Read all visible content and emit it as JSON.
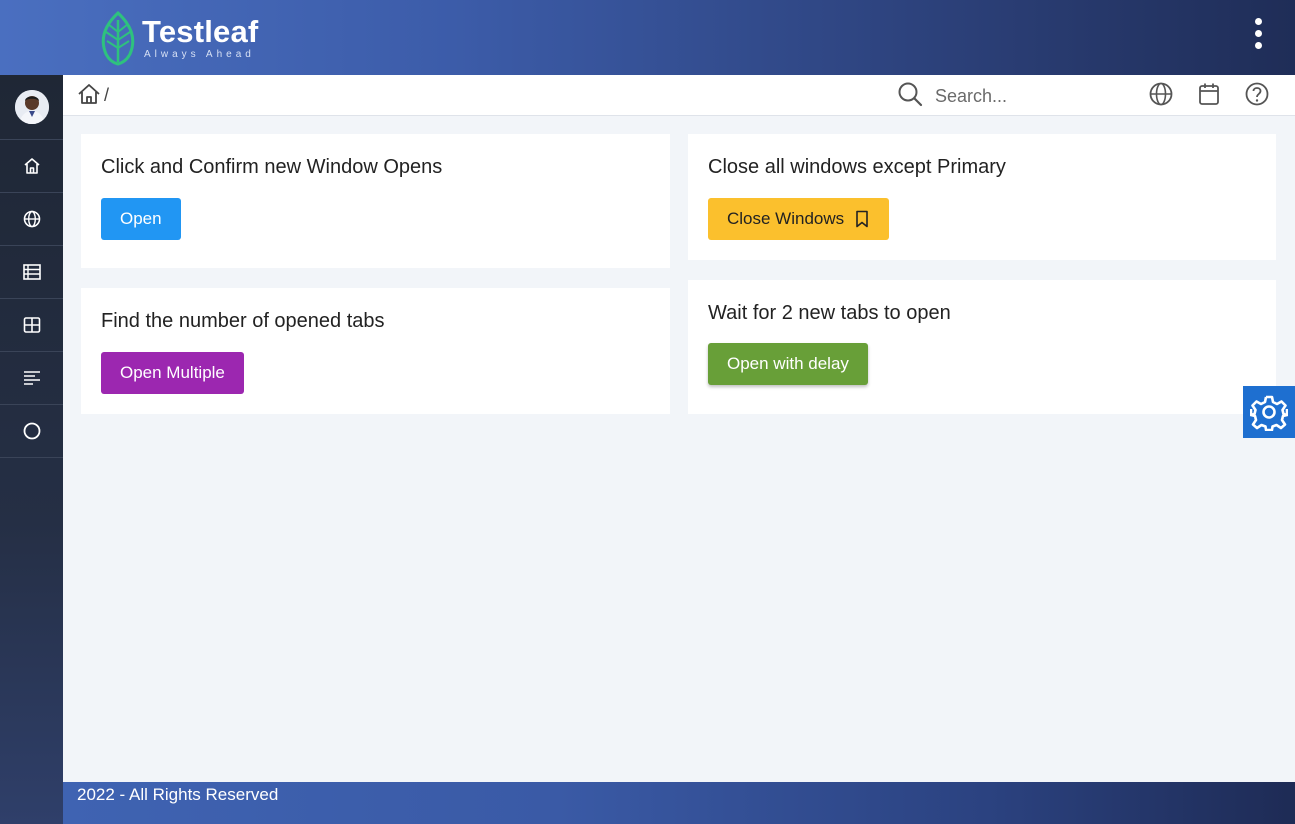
{
  "brand": {
    "name": "Testleaf",
    "tagline": "Always Ahead"
  },
  "header": {
    "menu_icon": "kebab-menu-icon"
  },
  "sidebar": {
    "items": [
      {
        "icon": "home-icon"
      },
      {
        "icon": "globe-icon"
      },
      {
        "icon": "table-icon"
      },
      {
        "icon": "grid-icon"
      },
      {
        "icon": "align-left-icon"
      },
      {
        "icon": "circle-icon"
      }
    ]
  },
  "breadcrumb": {
    "separator": "/"
  },
  "search": {
    "placeholder": "Search..."
  },
  "cards": {
    "window_open": {
      "title": "Click and Confirm new Window Opens",
      "button": "Open"
    },
    "close_windows": {
      "title": "Close all windows except Primary",
      "button": "Close Windows"
    },
    "count_tabs": {
      "title": "Find the number of opened tabs",
      "button": "Open Multiple"
    },
    "wait_tabs": {
      "title": "Wait for 2 new tabs to open",
      "button": "Open with delay"
    }
  },
  "footer": {
    "text": "2022 - All Rights Reserved"
  },
  "colors": {
    "button_blue": "#2196f3",
    "button_yellow": "#fbc02d",
    "button_purple": "#9c27b0",
    "button_green": "#689f38",
    "settings_blue": "#1e6fd0"
  }
}
